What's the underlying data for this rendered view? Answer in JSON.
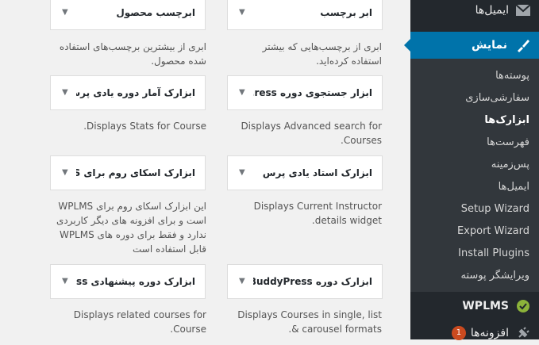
{
  "sidebar": {
    "top_item": {
      "label": "ایمیل‌ها",
      "icon": "envelope-icon"
    },
    "current": {
      "label": "نمایش",
      "icon": "paintbrush-icon"
    },
    "submenu": [
      {
        "label": "پوسته‌ها",
        "active": false
      },
      {
        "label": "سفارشی‌سازی",
        "active": false
      },
      {
        "label": "ابزارک‌ها",
        "active": true
      },
      {
        "label": "فهرست‌ها",
        "active": false
      },
      {
        "label": "پس‌زمینه",
        "active": false
      },
      {
        "label": "ایمیل‌ها",
        "active": false
      },
      {
        "label": "Setup Wizard",
        "active": false
      },
      {
        "label": "Export Wizard",
        "active": false
      },
      {
        "label": "Install Plugins",
        "active": false
      },
      {
        "label": "ویرایشگر پوسته",
        "active": false
      }
    ],
    "wplms": {
      "label": "WPLMS",
      "icon": "wplms-check-icon"
    },
    "plugins": {
      "label": "افزونه‌ها",
      "icon": "plug-icon",
      "badge": "1"
    }
  },
  "widgets": [
    {
      "title": "ابر برچسب",
      "desc": "ابری از برچسب‌هایی که بیشتر استفاده کرده‌اید."
    },
    {
      "title": "ابرچسب محصول",
      "desc": "ابری از بیشترین برچسب‌های استفاده شده محصول."
    },
    {
      "title": "ابزار جستجوی دوره ress...",
      "desc": "Displays Advanced search for Courses."
    },
    {
      "title": "ابزارک آمار دوره یادی پرس",
      "desc": "Displays Stats for Course."
    },
    {
      "title": "ابزارک استاد یادی پرس",
      "desc": "Displays Current Instructor details widget."
    },
    {
      "title": "ابزارک اسکای روم برای S...",
      "desc": "این ابزارک اسکای روم برای WPLMS است و برای افزونه های دیگر کاربردی ندارد و فقط برای دوره های WPLMS قابل استفاده است"
    },
    {
      "title": "ابزارک دوره BuddyPress",
      "desc": "Displays Courses in single, list & carousel formats."
    },
    {
      "title": "ابزارک دوره پیشنهادی ess...",
      "desc": "Displays related courses for Course."
    }
  ]
}
